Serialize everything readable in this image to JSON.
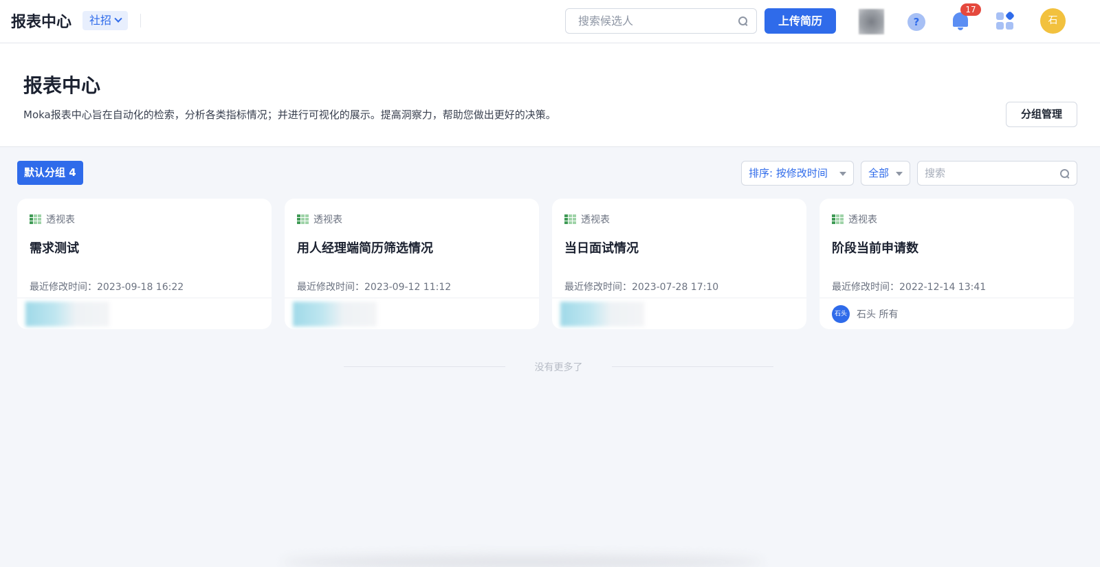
{
  "topbar": {
    "app_title": "报表中心",
    "biz_type": "社招",
    "search_placeholder": "搜索候选人",
    "upload_label": "上传简历",
    "help_symbol": "?",
    "notification_count": "17",
    "avatar_text": "石"
  },
  "header": {
    "title": "报表中心",
    "description": "Moka报表中心旨在自动化的检索，分析各类指标情况；并进行可视化的展示。提高洞察力，帮助您做出更好的决策。",
    "group_manage_label": "分组管理"
  },
  "toolbar": {
    "group_tag": "默认分组 4",
    "sort_label": "排序: 按修改时间",
    "filter_label": "全部",
    "search_placeholder": "搜索"
  },
  "cards": [
    {
      "type": "透视表",
      "title": "需求测试",
      "modified": "最近修改时间：2023-09-18 16:22"
    },
    {
      "type": "透视表",
      "title": "用人经理端简历筛选情况",
      "modified": "最近修改时间：2023-09-12 11:12"
    },
    {
      "type": "透视表",
      "title": "当日面试情况",
      "modified": "最近修改时间：2023-07-28 17:10"
    },
    {
      "type": "透视表",
      "title": "阶段当前申请数",
      "modified": "最近修改时间：2022-12-14 13:41",
      "owner_avatar": "石头",
      "owner_label": "石头 所有"
    }
  ],
  "footer": {
    "no_more": "没有更多了"
  },
  "colors": {
    "primary": "#2f6bea",
    "badge": "#e5483d",
    "avatar": "#f2c13e"
  }
}
